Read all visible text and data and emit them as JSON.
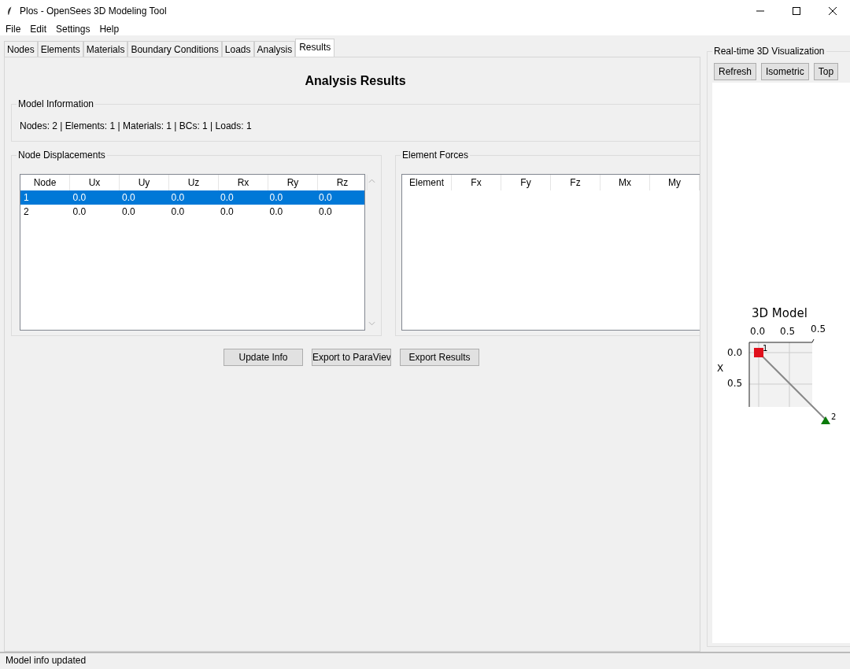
{
  "window": {
    "title": "Plos - OpenSees 3D Modeling Tool"
  },
  "menu": [
    "File",
    "Edit",
    "Settings",
    "Help"
  ],
  "tabs": [
    {
      "label": "Nodes",
      "selected": false
    },
    {
      "label": "Elements",
      "selected": false
    },
    {
      "label": "Materials",
      "selected": false
    },
    {
      "label": "Boundary Conditions",
      "selected": false
    },
    {
      "label": "Loads",
      "selected": false
    },
    {
      "label": "Analysis",
      "selected": false
    },
    {
      "label": "Results",
      "selected": true
    }
  ],
  "heading": "Analysis Results",
  "model_info": {
    "title": "Model Information",
    "text": "Nodes: 2 | Elements: 1 | Materials: 1 | BCs: 1 | Loads: 1"
  },
  "node_displacements": {
    "title": "Node Displacements",
    "columns": [
      "Node",
      "Ux",
      "Uy",
      "Uz",
      "Rx",
      "Ry",
      "Rz"
    ],
    "rows": [
      {
        "cells": [
          "1",
          "0.0",
          "0.0",
          "0.0",
          "0.0",
          "0.0",
          "0.0"
        ],
        "selected": true
      },
      {
        "cells": [
          "2",
          "0.0",
          "0.0",
          "0.0",
          "0.0",
          "0.0",
          "0.0"
        ],
        "selected": false
      }
    ]
  },
  "element_forces": {
    "title": "Element Forces",
    "columns": [
      "Element",
      "Fx",
      "Fy",
      "Fz",
      "Mx",
      "My"
    ]
  },
  "buttons": [
    "Update Info",
    "Export to ParaViev",
    "Export Results"
  ],
  "visualization": {
    "title": "Real-time 3D Visualization",
    "buttons": [
      "Refresh",
      "Isometric",
      "Top"
    ],
    "plot": {
      "title": "3D Model",
      "top_ticks": [
        "0.0",
        "0.5"
      ],
      "corner_tick": "0.5",
      "left_ticks": [
        "0.0",
        "0.5"
      ],
      "axis_label": "X",
      "node_labels": [
        "1",
        "2"
      ]
    }
  },
  "status_bar": "Model info updated"
}
